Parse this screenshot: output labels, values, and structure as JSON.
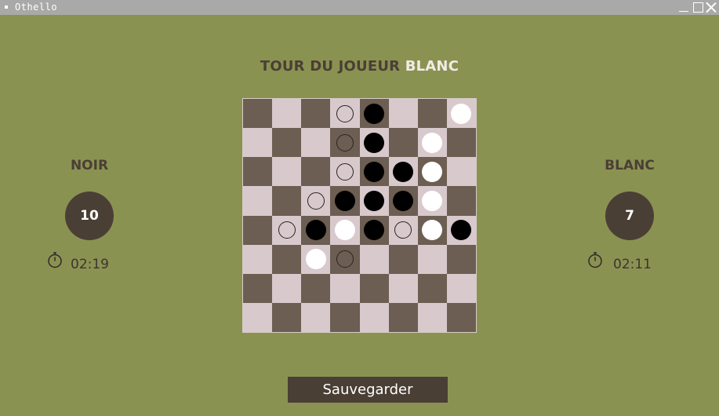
{
  "window": {
    "title": "Othello"
  },
  "turn": {
    "prefix": "TOUR DU JOUEUR ",
    "player": "BLANC"
  },
  "left_player": {
    "name": "NOIR",
    "score": "10",
    "time": "02:19"
  },
  "right_player": {
    "name": "BLANC",
    "score": "7",
    "time": "02:11"
  },
  "board": {
    "size": 8,
    "rows": [
      "...o#..W",
      "...o#.W.",
      "...o##W.",
      "..o###W.",
      ".o#W#oW#",
      "..Wo....",
      "........",
      "........"
    ],
    "legend": {
      "#": "black",
      "W": "white",
      "o": "possible-move",
      ".": "empty"
    }
  },
  "colors": {
    "background": "#8a9252",
    "dark_square": "#6c5e52",
    "light_square": "#d8c9cd",
    "accent": "#4a3f35"
  },
  "actions": {
    "save_label": "Sauvegarder"
  }
}
